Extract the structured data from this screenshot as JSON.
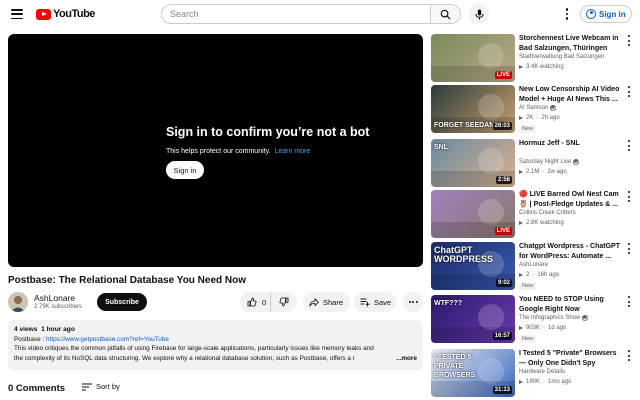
{
  "header": {
    "logo_text": "YouTube",
    "search_placeholder": "Search",
    "signin_label": "Sign in"
  },
  "player": {
    "gate_title": "Sign in to confirm you’re not a bot",
    "gate_subtitle": "This helps protect our community.",
    "gate_learn_more": "Learn more",
    "gate_button": "Sign in"
  },
  "video": {
    "title": "Postbase: The Relational Database You Need Now",
    "channel": "AshLonare",
    "subscribers": "2.79K subscribers",
    "subscribe_label": "Subscribe",
    "likes": "0",
    "share_label": "Share",
    "save_label": "Save"
  },
  "description": {
    "views": "4 views",
    "age": "1 hour ago",
    "link_prefix": "Postbase : ",
    "link": "https://www.getpostbase.com?ref=YouTube",
    "line1": "This video critiques the common pitfalls of using Firebase for large-scale applications, particularly issues like memory leaks and",
    "line2": "the complexity of its NoSQL data structuring. We explore why a relational database solution, such as Postbase, offers a r",
    "more_label": "...more"
  },
  "comments": {
    "count_label": "0 Comments",
    "sort_label": "Sort by"
  },
  "recommendations": [
    {
      "title": "Storchennest Live Webcam in Bad Salzungen, Thüringen",
      "channel": "Stadtverwaltung Bad Salzungen",
      "verified": false,
      "stats": "3.4K watching",
      "age": "",
      "badge": "LIVE",
      "new": "",
      "thumb_colors": [
        "#7a8a5a",
        "#b9a98a"
      ]
    },
    {
      "title": "New Low Censorship AI Video Model + Huge AI News This ...",
      "channel": "AI Samson",
      "verified": true,
      "stats": "2K",
      "age": "2h ago",
      "badge": "26:03",
      "new": "New",
      "thumb_colors": [
        "#2a3a3a",
        "#c8a070"
      ],
      "thumb_text": "FORGET SEEDANCE"
    },
    {
      "title": "Hormuz Jeff - SNL",
      "channel": "Saturday Night Live",
      "verified": true,
      "stats": "2.1M",
      "age": "2w ago",
      "badge": "2:58",
      "new": "",
      "thumb_colors": [
        "#6a8aa0",
        "#d8b090"
      ],
      "thumb_text": "SNL"
    },
    {
      "title": "🔴 LIVE Barred Owl Nest Cam 🦉 | Post-Fledge Updates & ...",
      "channel": "Collins Creek Critters",
      "verified": false,
      "stats": "2.8K watching",
      "age": "",
      "badge": "LIVE",
      "new": "",
      "thumb_colors": [
        "#a080c0",
        "#8a7a6a"
      ]
    },
    {
      "title": "Chatgpt Wordpress - ChatGPT for WordPress: Automate ...",
      "channel": "AshLonare",
      "verified": false,
      "stats": "2",
      "age": "16h ago",
      "badge": "9:02",
      "new": "New",
      "thumb_colors": [
        "#1a2a6a",
        "#3a5ab0"
      ],
      "thumb_text": "ChatGPT WORDPRESS"
    },
    {
      "title": "You NEED to STOP Using Google Right Now",
      "channel": "The Infographics Show",
      "verified": true,
      "stats": "903K",
      "age": "1d ago",
      "badge": "16:57",
      "new": "New",
      "thumb_colors": [
        "#2a1a6a",
        "#6a3ab0"
      ],
      "thumb_text": "WTF???"
    },
    {
      "title": "I Tested 5 \"Private\" Browsers — Only One Didn't Spy",
      "channel": "Hardware Details",
      "verified": false,
      "stats": "190K",
      "age": "1mo ago",
      "badge": "31:13",
      "new": "",
      "thumb_colors": [
        "#e8e8ee",
        "#3a6ac0"
      ],
      "thumb_text": "I TESTED 5 PRIVATE BROWSERS"
    }
  ]
}
